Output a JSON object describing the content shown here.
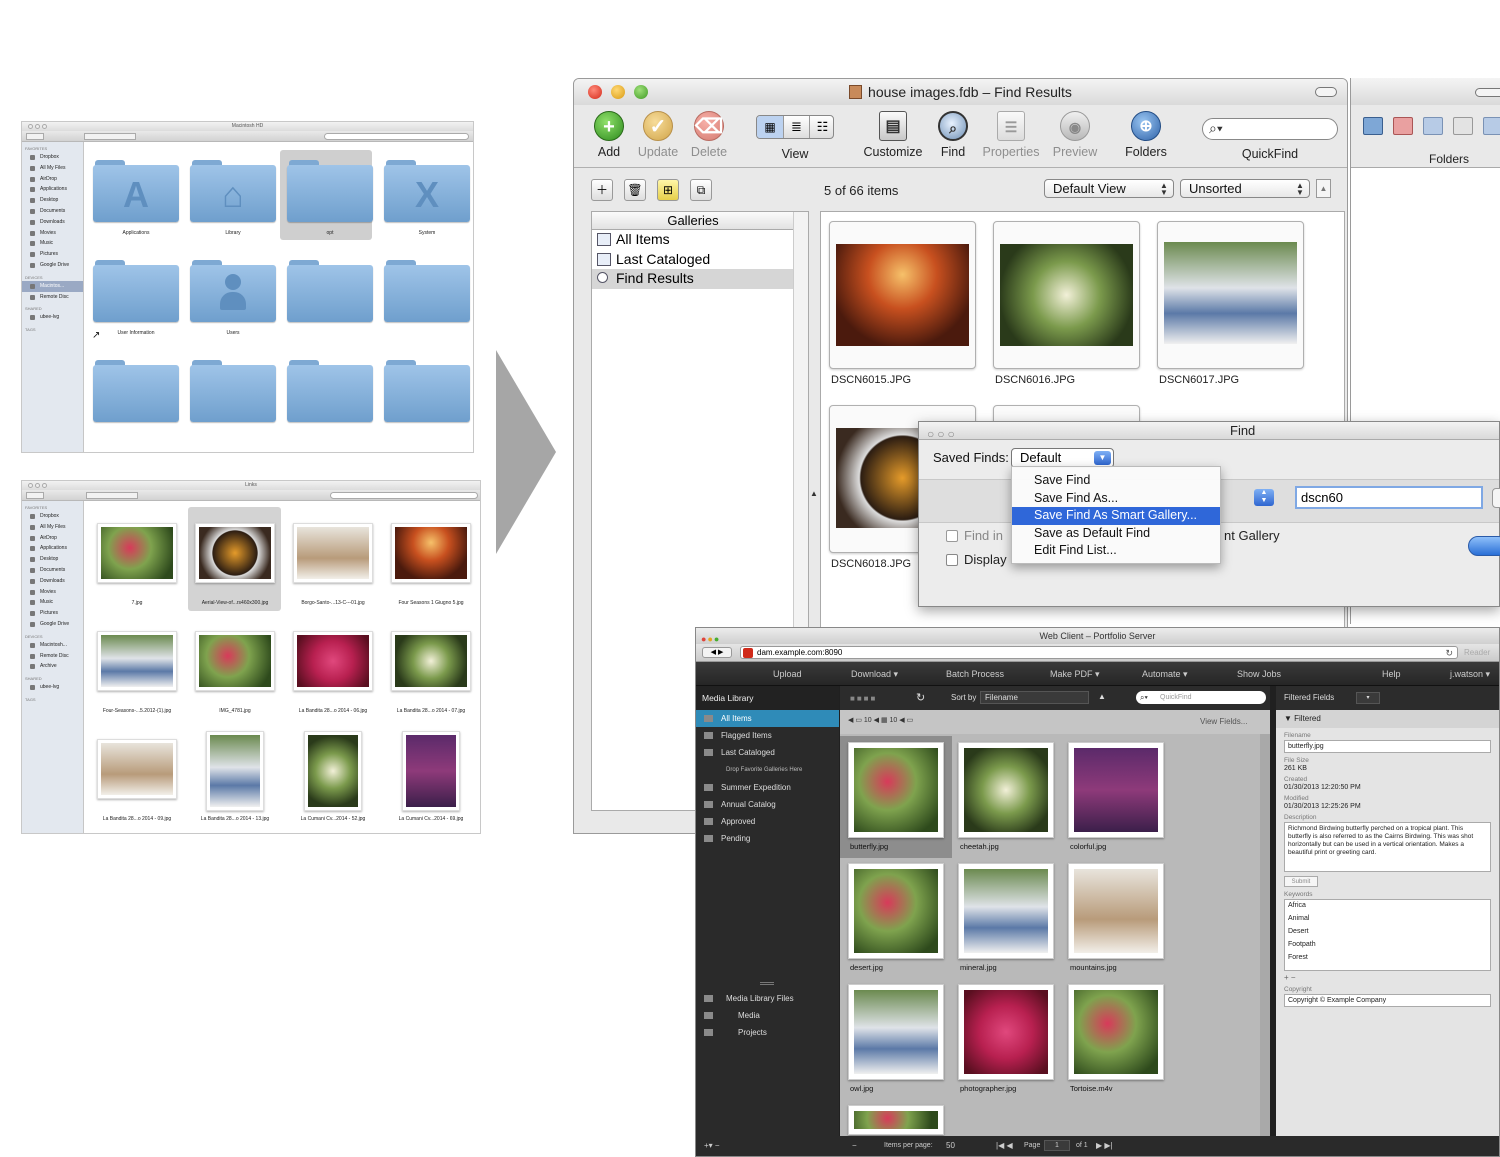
{
  "finder1": {
    "title": "Macintosh HD",
    "sidebar": {
      "favorites_header": "FAVORITES",
      "favorites": [
        "Dropbox",
        "All My Files",
        "AirDrop",
        "Applications",
        "Desktop",
        "Documents",
        "Downloads",
        "Movies",
        "Music",
        "Pictures",
        "Google Drive"
      ],
      "devices_header": "DEVICES",
      "devices": [
        "Macintos...",
        "Remote Disc"
      ],
      "shared_header": "SHARED",
      "shared": [
        "ubee-lvg"
      ],
      "tags_header": "TAGS"
    },
    "folders": [
      "Applications",
      "Library",
      "opt",
      "System",
      "User Information",
      "Users",
      "",
      "",
      "",
      "",
      "",
      ""
    ]
  },
  "finder2": {
    "title": "Links",
    "sidebar": {
      "favorites_header": "FAVORITES",
      "favorites": [
        "Dropbox",
        "All My Files",
        "AirDrop",
        "Applications",
        "Desktop",
        "Documents",
        "Downloads",
        "Movies",
        "Music",
        "Pictures",
        "Google Drive"
      ],
      "devices_header": "DEVICES",
      "devices": [
        "Macintosh...",
        "Remote Disc",
        "Archive"
      ],
      "shared_header": "SHARED",
      "shared": [
        "ubee-lvg"
      ],
      "tags_header": "TAGS"
    },
    "files": [
      "7.jpg",
      "Aerial-View-of...rs460x300.jpg",
      "Borgo-Santo-...13-C---01.jpg",
      "Four Seasons 1 Giugno 5.jpg",
      "Four-Seasons-...5.2012-(1).jpg",
      "IMG_4781.jpg",
      "La Bandita 28...o 2014 - 06.jpg",
      "La Bandita 28...o 2014 - 07.jpg",
      "La Bandita 28...o 2014 - 09.jpg",
      "La Bandita 28...o 2014 - 13.jpg",
      "La Cumani Cv...2014 - 52.jpg",
      "La Cumani Cv...2014 - 69.jpg"
    ]
  },
  "portfolio": {
    "title": "house images.fdb – Find Results",
    "toolbar": {
      "add": "Add",
      "update": "Update",
      "delete": "Delete",
      "view": "View",
      "customize": "Customize",
      "find": "Find",
      "properties": "Properties",
      "preview": "Preview",
      "folders": "Folders",
      "quickfind": "QuickFind"
    },
    "count": "5 of 66 items",
    "view_select": "Default View",
    "sort_select": "Unsorted",
    "galleries_header": "Galleries",
    "galleries": [
      "All Items",
      "Last Cataloged",
      "Find Results"
    ],
    "items": [
      "DSCN6015.JPG",
      "DSCN6016.JPG",
      "DSCN6017.JPG",
      "DSCN6018.JPG"
    ],
    "folders_panel_title": "Folders"
  },
  "find_dialog": {
    "title": "Find",
    "saved_finds_label": "Saved Finds:",
    "saved_finds_value": "Default",
    "search_value": "dscn60",
    "find_in_label": "Find in",
    "display_label": "Display",
    "gallery_text": "nt Gallery",
    "menu": [
      "Save Find",
      "Save Find As...",
      "Save Find As Smart Gallery...",
      "Save as Default Find",
      "Edit Find List..."
    ]
  },
  "web_client": {
    "title": "Web Client – Portfolio Server",
    "url": "dam.example.com:8090",
    "reader": "Reader",
    "menu": [
      "Upload",
      "Download ▾",
      "Batch Process",
      "Make PDF ▾",
      "Automate ▾",
      "Show Jobs",
      "Help",
      "j.watson ▾"
    ],
    "media_library": "Media Library",
    "sidebar": [
      "All Items",
      "Flagged Items",
      "Last Cataloged",
      "Drop Favorite Galleries Here",
      "Summer Expedition",
      "Annual Catalog",
      "Approved",
      "Pending"
    ],
    "files_header": "Media Library Files",
    "files": [
      "Media",
      "Projects"
    ],
    "sort_by_label": "Sort by",
    "sort_by_value": "Filename",
    "quickfind_placeholder": "QuickFind",
    "view_fields": "View Fields...",
    "items": [
      "butterfly.jpg",
      "cheetah.jpg",
      "colorful.jpg",
      "desert.jpg",
      "mineral.jpg",
      "mountains.jpg",
      "owl.jpg",
      "photographer.jpg",
      "Tortoise.m4v"
    ],
    "right": {
      "header": "Filtered Fields",
      "filtered": "Filtered",
      "filename_label": "Filename",
      "filename": "butterfly.jpg",
      "filesize_label": "File Size",
      "filesize": "261 KB",
      "created_label": "Created",
      "created": "01/30/2013 12:20:50 PM",
      "modified_label": "Modified",
      "modified": "01/30/2013 12:25:26 PM",
      "description_label": "Description",
      "description": "Richmond Birdwing butterfly perched on a tropical plant. This butterfly is also referred to as the Cairns Birdwing. This was shot horizontally but can be used in a vertical orientation. Makes a beautiful print or greeting card.",
      "submit": "Submit",
      "keywords_label": "Keywords",
      "keywords": [
        "Africa",
        "Animal",
        "Desert",
        "Footpath",
        "Forest"
      ],
      "copyright_label": "Copyright",
      "copyright": "Copyright © Example Company"
    },
    "footer": {
      "items_per_page_label": "Items per page:",
      "items_per_page": "50",
      "page_label": "Page",
      "page": "1",
      "of": "of 1"
    }
  },
  "colors": {
    "accent": "#2f67d9",
    "web_selected": "#2f8bb8",
    "folder": "#8fb8e0"
  }
}
